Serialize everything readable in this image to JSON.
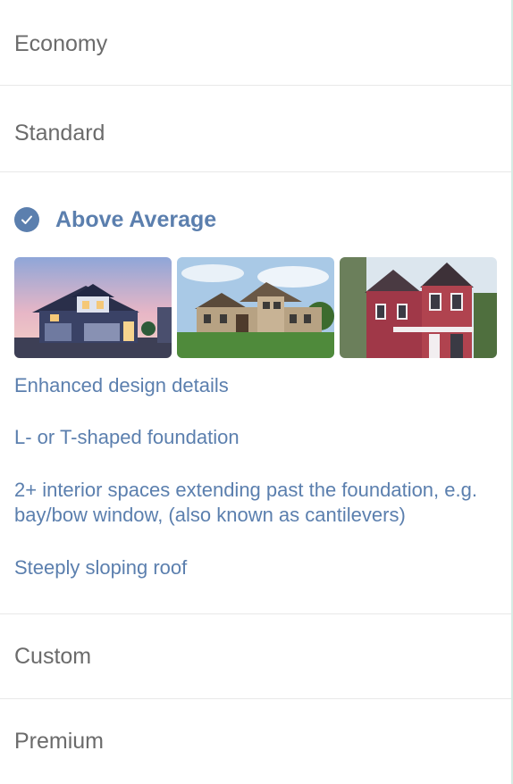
{
  "options": {
    "economy": "Economy",
    "standard": "Standard",
    "above_average": "Above Average",
    "custom": "Custom",
    "premium": "Premium"
  },
  "selected": {
    "features": [
      "Enhanced design details",
      "L- or T-shaped foundation",
      "2+ interior spaces extending past the foundation, e.g. bay/bow window, (also known as cantilevers)",
      "Steeply sloping roof"
    ]
  },
  "colors": {
    "accent": "#5b7fae",
    "option_text": "#6b6b6b",
    "divider": "#e8e8e8"
  }
}
